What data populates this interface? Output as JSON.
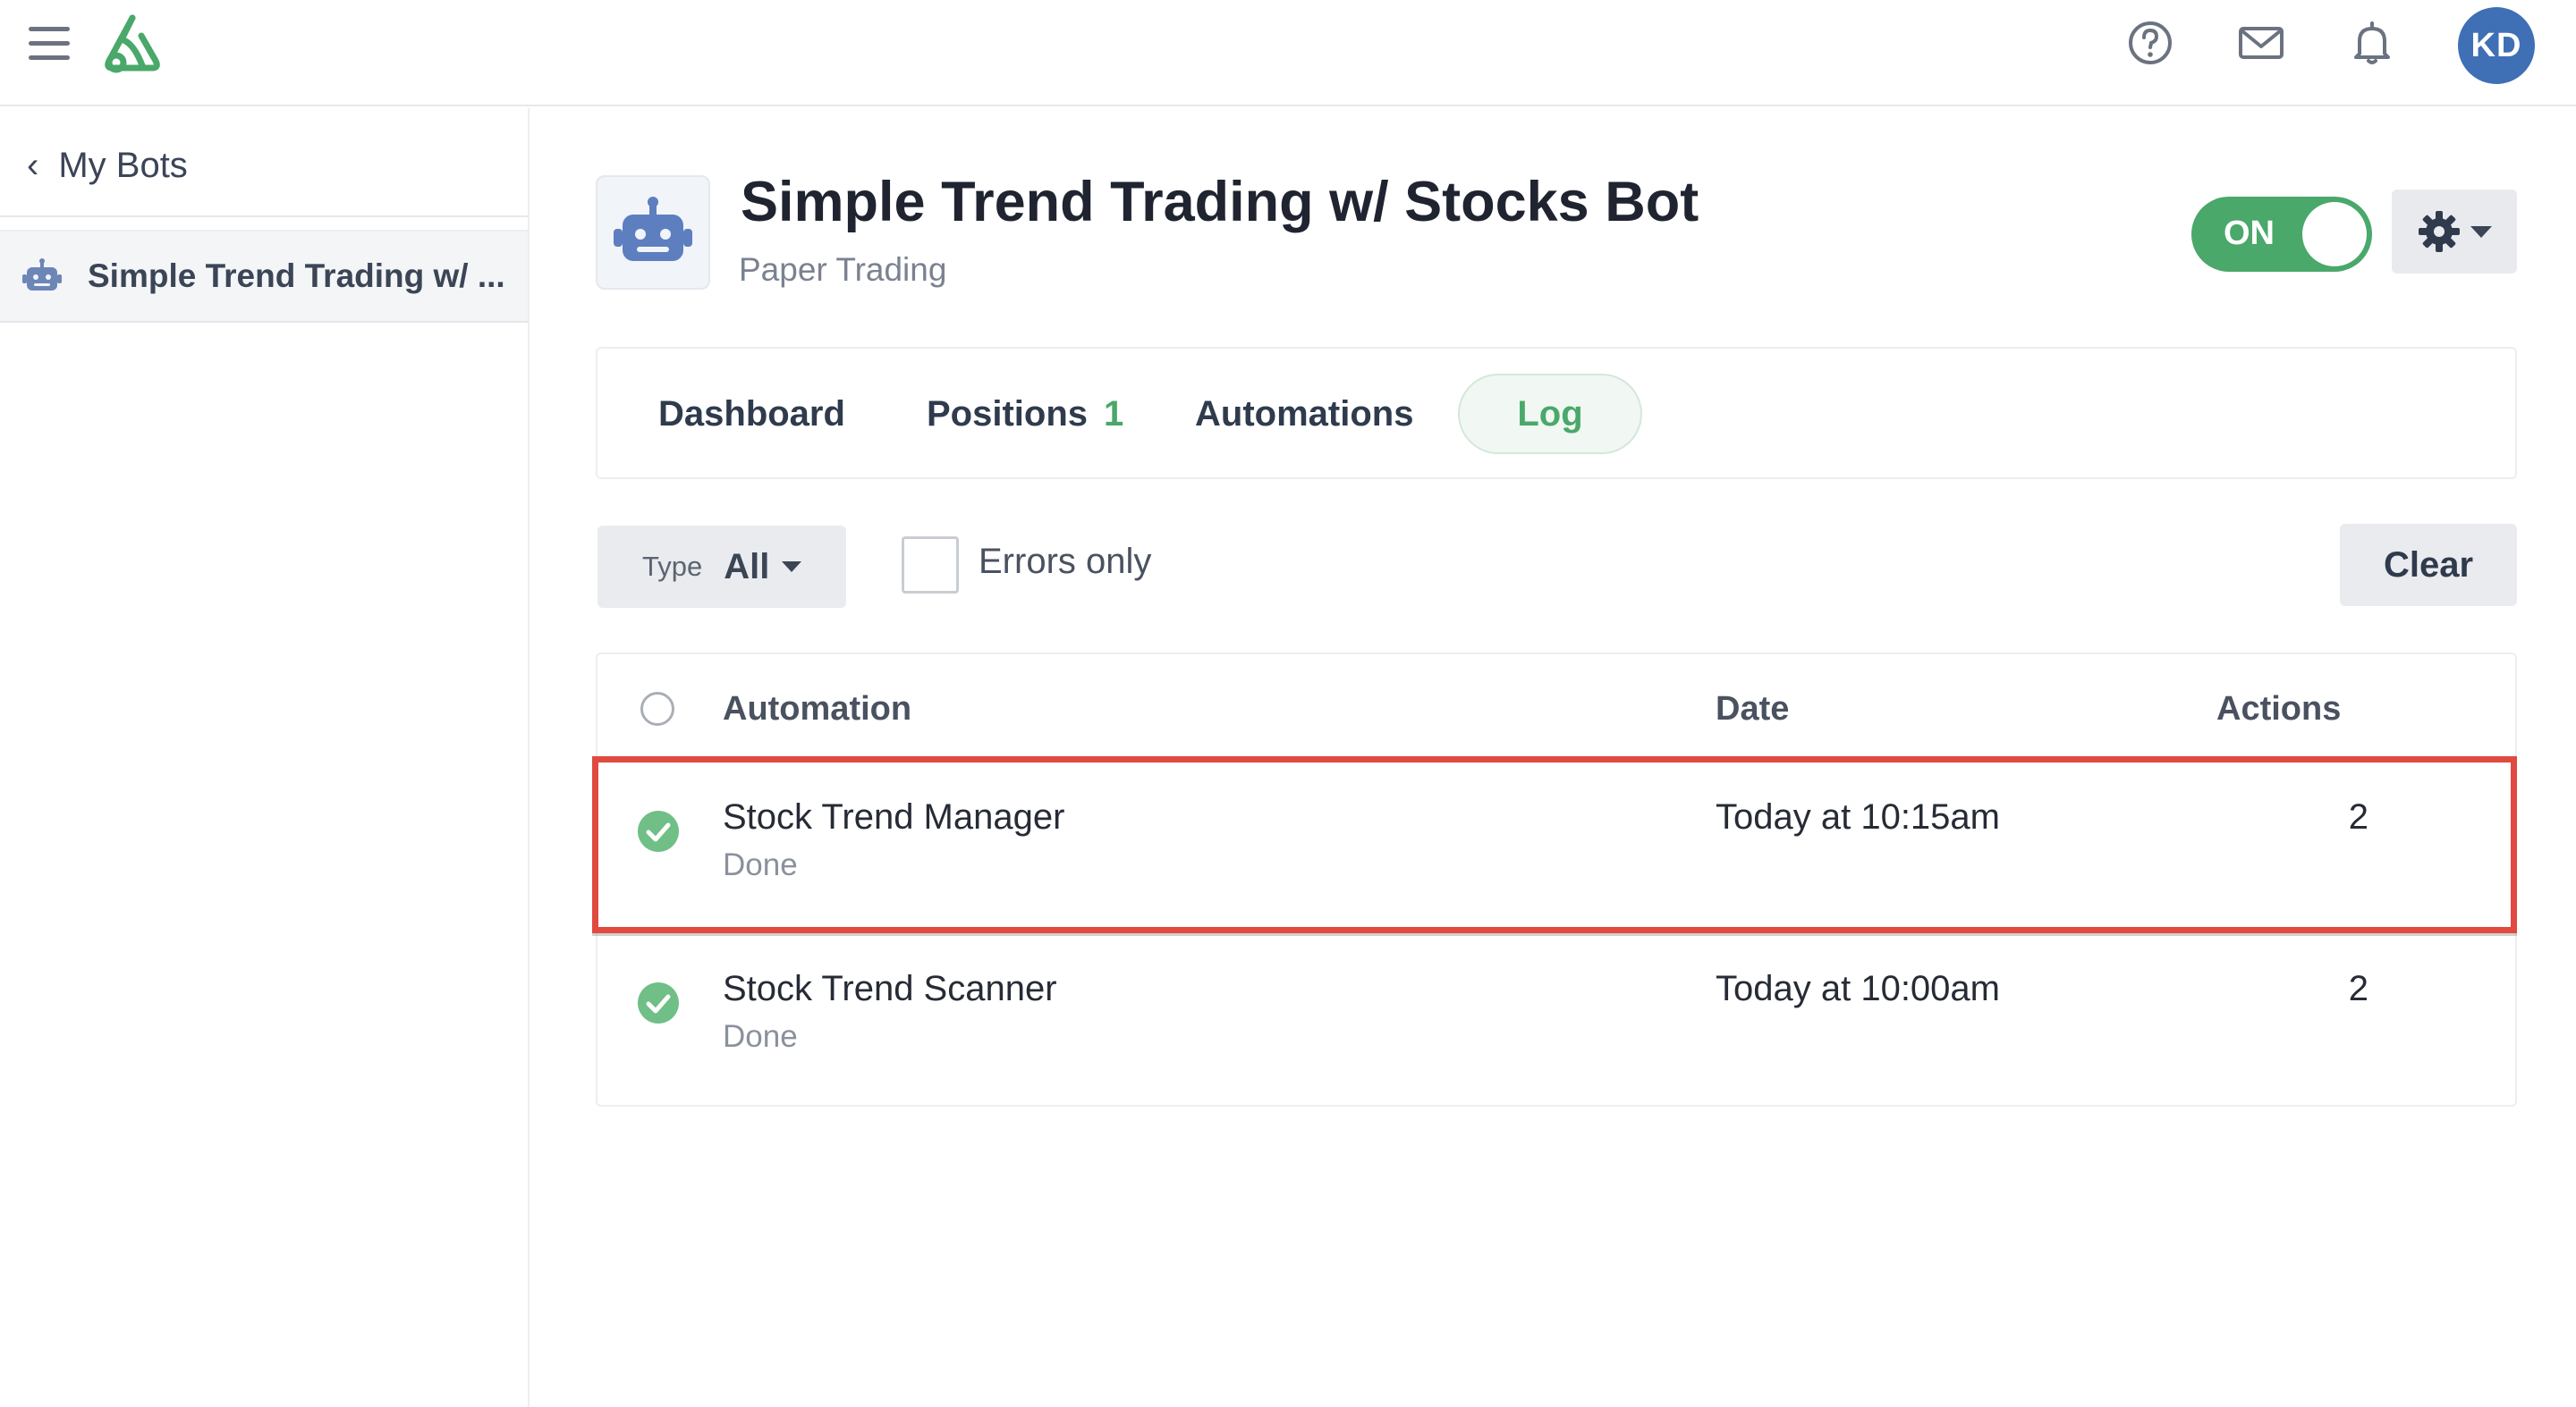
{
  "topbar": {
    "menu_icon": "hamburger-icon",
    "logo_icon": "app-logo",
    "help_icon": "help-circle-icon",
    "mail_icon": "mail-icon",
    "bell_icon": "bell-icon",
    "avatar_initials": "KD",
    "avatar_color": "#3f6fb4"
  },
  "sidebar": {
    "back_label": "My Bots",
    "items": [
      {
        "label": "Simple Trend Trading w/ ...",
        "icon": "robot-icon"
      }
    ]
  },
  "bot": {
    "title": "Simple Trend Trading w/ Stocks Bot",
    "subtitle": "Paper Trading",
    "toggle_label": "ON",
    "toggle_state": "on"
  },
  "tabs": [
    {
      "label": "Dashboard"
    },
    {
      "label": "Positions",
      "badge": "1"
    },
    {
      "label": "Automations"
    },
    {
      "label": "Log",
      "active": true
    }
  ],
  "filters": {
    "type_label": "Type",
    "type_value": "All",
    "errors_only_label": "Errors only",
    "errors_only_checked": false,
    "clear_label": "Clear"
  },
  "table": {
    "columns": [
      "Automation",
      "Date",
      "Actions"
    ],
    "rows": [
      {
        "name": "Stock Trend Manager",
        "status": "Done",
        "date": "Today at 10:15am",
        "actions": "2"
      },
      {
        "name": "Stock Trend Scanner",
        "status": "Done",
        "date": "Today at 10:00am",
        "actions": "2"
      }
    ]
  },
  "colors": {
    "accent_green": "#49a86a",
    "highlight_red": "#e04a3f"
  }
}
